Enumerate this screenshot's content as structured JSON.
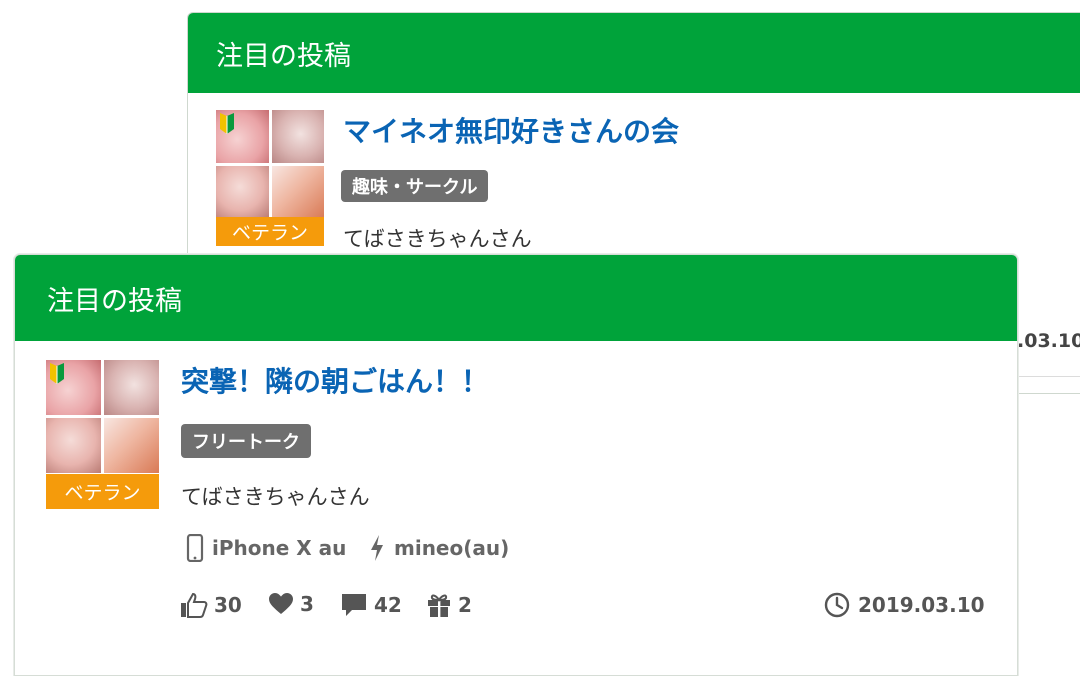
{
  "back_card": {
    "header": "注目の投稿",
    "title": "マイネオ無印好きさんの会",
    "tag": "趣味・サークル",
    "badge": "ベテラン",
    "author": "てばさきちゃんさん",
    "date_peek": ".03.10"
  },
  "front_card": {
    "header": "注目の投稿",
    "title": "突撃！隣の朝ごはん！！",
    "tag": "フリートーク",
    "badge": "ベテラン",
    "author": "てばさきちゃんさん",
    "device": "iPhone X au",
    "plan": "mineo(au)",
    "stats": {
      "likes": "30",
      "hearts": "3",
      "comments": "42",
      "gifts": "2"
    },
    "date": "2019.03.10"
  },
  "icons": {
    "beginner": "beginner-leaf-icon",
    "device": "smartphone-icon",
    "plan": "lightning-icon",
    "likes": "thumbs-up-icon",
    "hearts": "heart-icon",
    "comments": "comment-icon",
    "gifts": "gift-icon",
    "date": "clock-icon"
  },
  "colors": {
    "header_green": "#00a33a",
    "title_blue": "#0a64b4",
    "badge_orange": "#f59b0b",
    "tag_gray": "#6f6f6f"
  }
}
